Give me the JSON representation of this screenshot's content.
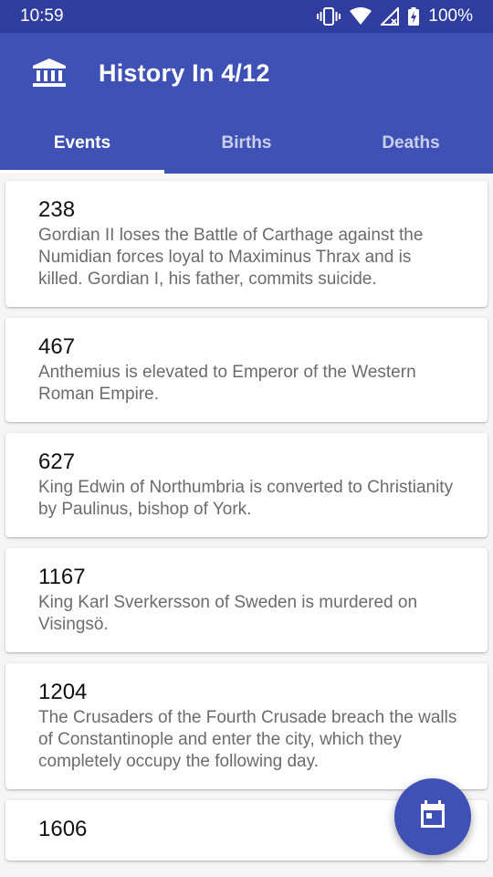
{
  "status_bar": {
    "time": "10:59",
    "battery": "100%",
    "icons": [
      "vibrate-icon",
      "wifi-icon",
      "signal-icon",
      "battery-charging-icon"
    ]
  },
  "app_bar": {
    "icon": "museum-icon",
    "title": "History In 4/12",
    "color": "#3f51b5",
    "status_color": "#2f3e9e"
  },
  "tabs": [
    {
      "label": "Events",
      "active": true
    },
    {
      "label": "Births",
      "active": false
    },
    {
      "label": "Deaths",
      "active": false
    }
  ],
  "events": [
    {
      "year": "238",
      "text": "Gordian II loses the Battle of Carthage against the Numidian forces loyal to Maximinus Thrax and is killed. Gordian I, his father, commits suicide."
    },
    {
      "year": "467",
      "text": "Anthemius is elevated to Emperor of the Western Roman Empire."
    },
    {
      "year": "627",
      "text": "King Edwin of Northumbria is converted to Christianity by Paulinus, bishop of York."
    },
    {
      "year": "1167",
      "text": "King Karl Sverkersson of Sweden is murdered on Visingsö."
    },
    {
      "year": "1204",
      "text": "The Crusaders of the Fourth Crusade breach the walls of Constantinople and enter the city, which they completely occupy the following day."
    },
    {
      "year": "1606",
      "text": ""
    }
  ],
  "fab": {
    "icon": "calendar-icon"
  }
}
